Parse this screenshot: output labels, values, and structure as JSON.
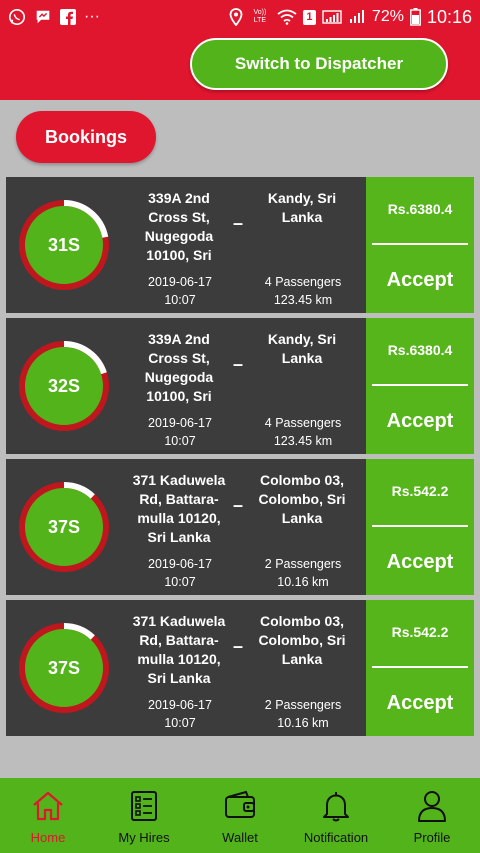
{
  "status_bar": {
    "more": "···",
    "volte": "Vo)) LTE",
    "sim": "1",
    "battery": "72%",
    "time": "10:16"
  },
  "header": {
    "switch_label": "Switch to Dispatcher"
  },
  "tab": {
    "bookings_label": "Bookings"
  },
  "bookings": [
    {
      "timer": "31S",
      "progress": 0.78,
      "from": [
        "339A 2nd",
        "Cross St,",
        "Nugegoda",
        "10100, Sri"
      ],
      "to": [
        "Kandy, Sri",
        "Lanka"
      ],
      "date": "2019-06-17",
      "time": "10:07",
      "passengers": "4 Passengers",
      "distance": "123.45 km",
      "fare": "Rs.6380.4",
      "accept": "Accept"
    },
    {
      "timer": "32S",
      "progress": 0.8,
      "from": [
        "339A 2nd",
        "Cross St,",
        "Nugegoda",
        "10100, Sri"
      ],
      "to": [
        "Kandy, Sri",
        "Lanka"
      ],
      "date": "2019-06-17",
      "time": "10:07",
      "passengers": "4 Passengers",
      "distance": "123.45 km",
      "fare": "Rs.6380.4",
      "accept": "Accept"
    },
    {
      "timer": "37S",
      "progress": 0.88,
      "from": [
        "371 Kaduwela",
        "Rd, Battara-",
        "mulla 10120,",
        "Sri Lanka"
      ],
      "to": [
        "Colombo 03,",
        "Colombo, Sri",
        "Lanka"
      ],
      "date": "2019-06-17",
      "time": "10:07",
      "passengers": "2 Passengers",
      "distance": "10.16 km",
      "fare": "Rs.542.2",
      "accept": "Accept"
    },
    {
      "timer": "37S",
      "progress": 0.88,
      "from": [
        "371 Kaduwela",
        "Rd, Battara-",
        "mulla 10120,",
        "Sri Lanka"
      ],
      "to": [
        "Colombo 03,",
        "Colombo, Sri",
        "Lanka"
      ],
      "date": "2019-06-17",
      "time": "10:07",
      "passengers": "2 Passengers",
      "distance": "10.16 km",
      "fare": "Rs.542.2",
      "accept": "Accept"
    }
  ],
  "nav": {
    "home": "Home",
    "my_hires": "My Hires",
    "wallet": "Wallet",
    "notification": "Notification",
    "profile": "Profile"
  },
  "colors": {
    "brand_red": "#e0162e",
    "brand_green": "#53b31a",
    "card_bg": "#3c3c3c",
    "ring_red": "#c0161e",
    "ring_white": "#ffffff"
  }
}
